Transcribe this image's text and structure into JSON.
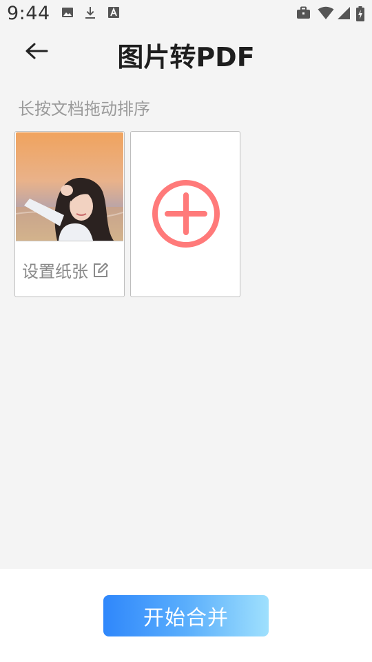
{
  "status_bar": {
    "time": "9:44",
    "left_icons": [
      "image-icon",
      "download-icon",
      "font-icon"
    ],
    "right_icons": [
      "briefcase-icon",
      "wifi-icon",
      "signal-icon",
      "battery-charging-icon"
    ]
  },
  "header": {
    "back_icon": "arrow-left-icon",
    "title": "图片转PDF"
  },
  "hint": "长按文档拖动排序",
  "documents": [
    {
      "thumbnail": "sunset-portrait-photo",
      "paper_setting_label": "设置纸张",
      "edit_icon": "edit-icon"
    }
  ],
  "add_button": {
    "icon": "plus-circle-icon",
    "color": "#ff7a7a"
  },
  "bottom": {
    "merge_label": "开始合并",
    "gradient": [
      "#2f87fb",
      "#9fe0fd"
    ]
  }
}
